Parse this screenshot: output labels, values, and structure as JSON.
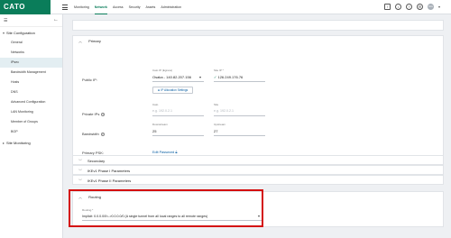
{
  "app": {
    "logo": "CATO",
    "nav": [
      "Monitoring",
      "Network",
      "Access",
      "Security",
      "Assets",
      "Administration"
    ],
    "active_nav": "Network",
    "avatar_initials": "GG"
  },
  "sidebar": {
    "section1": "Site Configuration",
    "items": [
      "General",
      "Networks",
      "IPsec",
      "Bandwidth Management",
      "Hosts",
      "DNS",
      "Advanced Configuration",
      "LAN Monitoring",
      "Member of Groups",
      "BGP"
    ],
    "active_item": "IPsec",
    "section2": "Site Monitoring"
  },
  "primary": {
    "title": "Primary",
    "public_ip_label": "Public IP:",
    "cato_ip_label": "Cato IP (Egress)",
    "cato_ip_value": "Osaka - 140.82.207.156",
    "site_ip_label": "Site IP *",
    "site_ip_value": "126.249.176.76",
    "alloc_button": "IP Allocation Settings",
    "private_ips_label": "Private IPs",
    "private_cato_label": "Cato",
    "private_cato_placeholder": "e.g. 192.0.2.1",
    "private_site_label": "Site",
    "private_site_placeholder": "e.g. 192.0.2.1",
    "bandwidth_label": "Bandwidth",
    "downstream_label": "Downstream",
    "downstream_value": "25",
    "upstream_label": "Upstream",
    "upstream_value": "27",
    "psk_label": "Primary PSK:",
    "psk_link": "Edit Password"
  },
  "collapsed_panels": [
    "Secondary",
    "IKEv1 Phase I Parameters",
    "IKEv1 Phase II Parameters"
  ],
  "routing": {
    "title": "Routing",
    "field_label": "Routing *",
    "value": "Implicit: 0.0.0.0/0<->0.0.0.0/0 (A single tunnel from all local ranges to all remote ranges)"
  }
}
